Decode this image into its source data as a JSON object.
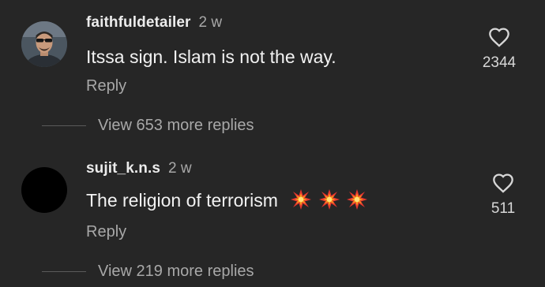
{
  "comments": [
    {
      "username": "faithfuldetailer",
      "time": "2 w",
      "text": "Itssa sign. Islam is not the way.",
      "reply_label": "Reply",
      "like_count": "2344",
      "view_more": "View 653 more replies",
      "avatar": "profile-photo"
    },
    {
      "username": "sujit_k.n.s",
      "time": "2 w",
      "text": "The religion of terrorism",
      "emojis": [
        "collision-icon",
        "collision-icon",
        "collision-icon"
      ],
      "reply_label": "Reply",
      "like_count": "511",
      "view_more": "View 219 more replies",
      "avatar": "black"
    }
  ],
  "colors": {
    "background": "#262626",
    "username": "#ececec",
    "secondary_text": "#a8a8a8",
    "body_text": "#f2f2f2"
  }
}
